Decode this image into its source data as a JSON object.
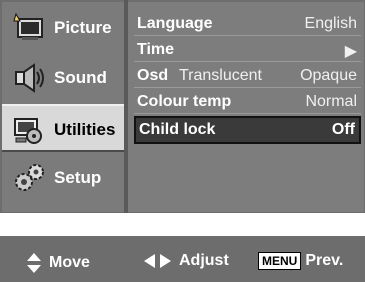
{
  "sidebar": {
    "items": [
      {
        "label": "Picture",
        "icon": "picture-icon",
        "active": false
      },
      {
        "label": "Sound",
        "icon": "speaker-icon",
        "active": false
      },
      {
        "label": "Utilities",
        "icon": "utilities-icon",
        "active": true
      },
      {
        "label": "Setup",
        "icon": "gears-icon",
        "active": false
      }
    ]
  },
  "settings": {
    "language": {
      "label": "Language",
      "value": "English"
    },
    "time": {
      "label": "Time",
      "value": "▶"
    },
    "osd": {
      "label": "Osd",
      "options": [
        "Translucent",
        "Opaque"
      ]
    },
    "colour_temp": {
      "label": "Colour temp",
      "value": "Normal"
    },
    "child_lock": {
      "label": "Child lock",
      "value": "Off"
    }
  },
  "footer": {
    "move": "Move",
    "adjust": "Adjust",
    "menu_key": "MENU",
    "prev": "Prev."
  },
  "colors": {
    "osd_background": "#6d6d6d",
    "panel_background": "#7d7d7d",
    "selected_background": "#3a3a3a"
  }
}
